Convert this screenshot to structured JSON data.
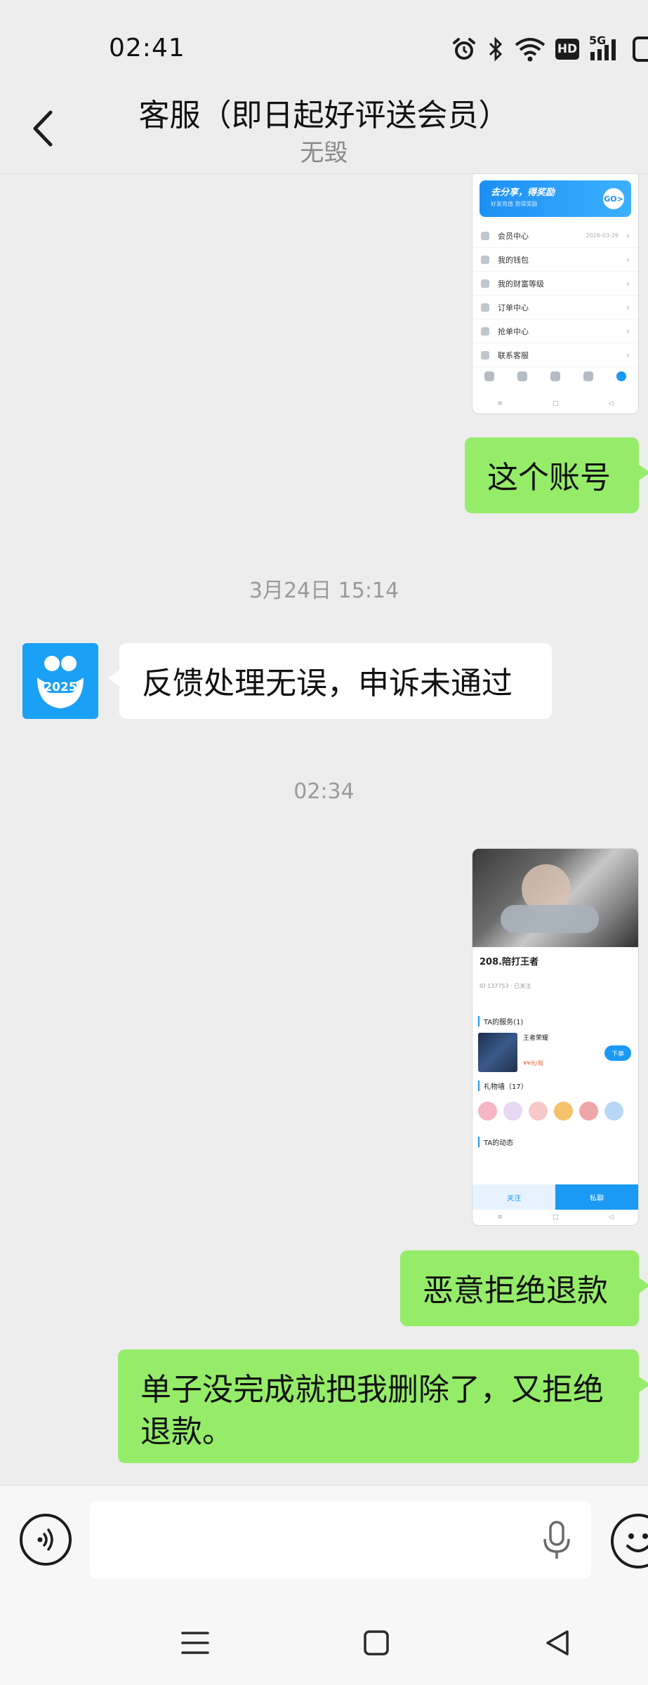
{
  "status_bar": {
    "time": "02:41",
    "icons": [
      "alarm-icon",
      "bluetooth-icon",
      "wifi-icon",
      "hd-icon",
      "5g-signal-icon",
      "battery-icon"
    ],
    "network_label": "5G",
    "hd_label": "HD"
  },
  "header": {
    "title": "客服（即日起好评送会员）",
    "subtitle": "无毁",
    "back_icon": "chevron-left-icon"
  },
  "messages": {
    "screenshot1": {
      "banner_title": "去分享，得奖励",
      "banner_sub": "好友充值 您得奖励",
      "banner_go": "GO>",
      "menu_items": [
        {
          "label": "会员中心",
          "date": "2026-03-29"
        },
        {
          "label": "我的钱包",
          "date": ""
        },
        {
          "label": "我的财富等级",
          "date": ""
        },
        {
          "label": "订单中心",
          "date": ""
        },
        {
          "label": "抢单中心",
          "date": ""
        },
        {
          "label": "联系客服",
          "date": ""
        }
      ]
    },
    "bubble1": "这个账号",
    "timestamp1": "3月24日 15:14",
    "avatar_text": "2025",
    "bubble2": "反馈处理无误，申诉未通过",
    "timestamp2": "02:34",
    "screenshot2": {
      "name": "208.陪打王者",
      "meta": "ID 137753 · 已关注",
      "services_title": "TA的服务(1)",
      "game_title": "王者荣耀",
      "game_price": "¥¥元/局",
      "order_button": "下单",
      "gifts_title": "礼物墙（17）",
      "moments_title": "TA的动态",
      "follow_button": "关注",
      "chat_button": "私聊"
    },
    "bubble3": "恶意拒绝退款",
    "bubble4": "单子没完成就把我删除了，又拒绝退款。"
  },
  "input_bar": {
    "placeholder": "",
    "voice_icon": "voice-input-icon",
    "mic_icon": "microphone-icon",
    "emoji_icon": "emoji-icon"
  },
  "system_nav": {
    "icons": [
      "menu-icon",
      "home-icon",
      "back-icon"
    ]
  },
  "colors": {
    "background": "#ededed",
    "sent_bubble": "#95ec69",
    "received_bubble": "#ffffff",
    "accent_blue": "#1a9af5"
  }
}
